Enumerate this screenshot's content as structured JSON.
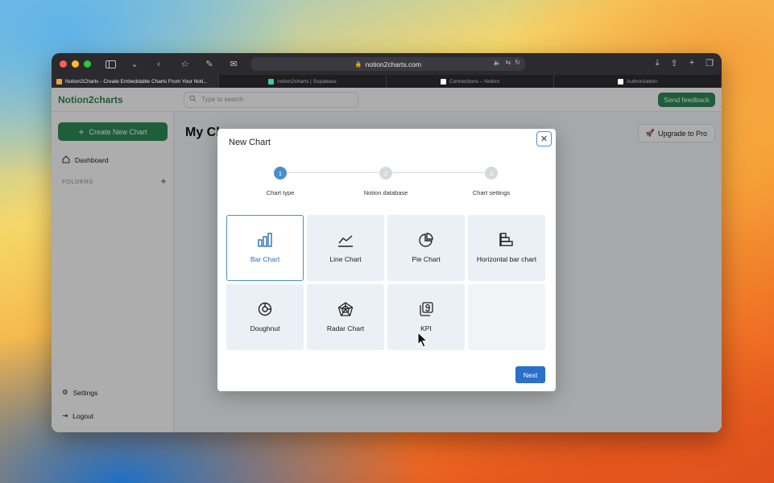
{
  "browser": {
    "url": "notion2charts.com",
    "tabs": [
      {
        "label": "Notion2Charts - Create Embeddable Charts From Your Noti...",
        "active": true,
        "favicon_color": "#e8a33c"
      },
      {
        "label": "notion2charts | Supabase",
        "active": false,
        "favicon_color": "#3ecf8e"
      },
      {
        "label": "Connections – Notion",
        "active": false,
        "favicon_color": "#ffffff"
      },
      {
        "label": "Authorization",
        "active": false,
        "favicon_color": "#ffffff"
      }
    ]
  },
  "topnav": {
    "logo": "Notion2charts",
    "search_placeholder": "Type to search",
    "feedback_label": "Send feedback"
  },
  "sidebar": {
    "create_label": "Create New Chart",
    "dashboard_label": "Dashboard",
    "folders_label": "FOLDERS",
    "settings_label": "Settings",
    "logout_label": "Logout"
  },
  "main": {
    "title": "My Ch",
    "upgrade_label": "Upgrade to Pro"
  },
  "modal": {
    "title": "New Chart",
    "steps": [
      {
        "number": "1",
        "label": "Chart type",
        "active": true
      },
      {
        "number": "2",
        "label": "Notion database",
        "active": false
      },
      {
        "number": "3",
        "label": "Chart settings",
        "active": false
      }
    ],
    "chart_types": [
      {
        "label": "Bar Chart",
        "icon": "bar-chart-icon",
        "selected": true
      },
      {
        "label": "Line Chart",
        "icon": "line-chart-icon",
        "selected": false
      },
      {
        "label": "Pie Chart",
        "icon": "pie-chart-icon",
        "selected": false
      },
      {
        "label": "Horizontal bar chart",
        "icon": "horizontal-bar-chart-icon",
        "selected": false
      },
      {
        "label": "Doughnut",
        "icon": "doughnut-chart-icon",
        "selected": false
      },
      {
        "label": "Radar Chart",
        "icon": "radar-chart-icon",
        "selected": false
      },
      {
        "label": "KPI",
        "icon": "kpi-icon",
        "selected": false
      }
    ],
    "next_label": "Next"
  },
  "colors": {
    "brand_green": "#2e8b57",
    "accent_blue": "#2a6fc9",
    "step_active": "#4a90c8",
    "step_inactive": "#d6d9dd"
  }
}
